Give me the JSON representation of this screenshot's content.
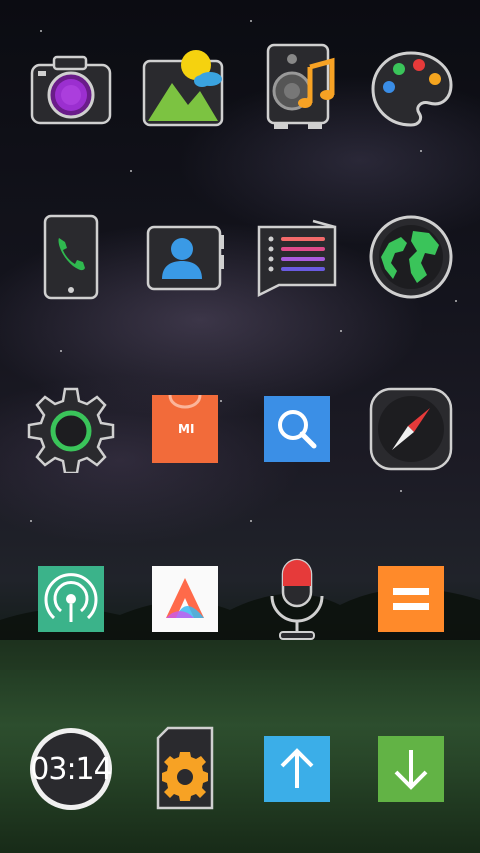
{
  "clock": {
    "time": "03:14"
  },
  "store": {
    "brand": "MI"
  },
  "apps": [
    {
      "row": 0,
      "col": 0,
      "icon": "camera-icon"
    },
    {
      "row": 0,
      "col": 1,
      "icon": "gallery-icon"
    },
    {
      "row": 0,
      "col": 2,
      "icon": "music-player-icon"
    },
    {
      "row": 0,
      "col": 3,
      "icon": "themes-palette-icon"
    },
    {
      "row": 1,
      "col": 0,
      "icon": "phone-icon"
    },
    {
      "row": 1,
      "col": 1,
      "icon": "contacts-icon"
    },
    {
      "row": 1,
      "col": 2,
      "icon": "messages-icon"
    },
    {
      "row": 1,
      "col": 3,
      "icon": "browser-globe-icon"
    },
    {
      "row": 2,
      "col": 0,
      "icon": "settings-gear-icon"
    },
    {
      "row": 2,
      "col": 1,
      "icon": "mi-store-icon"
    },
    {
      "row": 2,
      "col": 2,
      "icon": "search-icon"
    },
    {
      "row": 2,
      "col": 3,
      "icon": "compass-icon"
    },
    {
      "row": 3,
      "col": 0,
      "icon": "hotspot-icon"
    },
    {
      "row": 3,
      "col": 1,
      "icon": "app-launcher-icon"
    },
    {
      "row": 3,
      "col": 2,
      "icon": "voice-recorder-icon"
    },
    {
      "row": 3,
      "col": 3,
      "icon": "calculator-icon"
    },
    {
      "row": 4,
      "col": 0,
      "icon": "clock-icon"
    },
    {
      "row": 4,
      "col": 1,
      "icon": "sd-settings-icon"
    },
    {
      "row": 4,
      "col": 2,
      "icon": "upload-arrow-icon"
    },
    {
      "row": 4,
      "col": 3,
      "icon": "download-arrow-icon"
    }
  ]
}
